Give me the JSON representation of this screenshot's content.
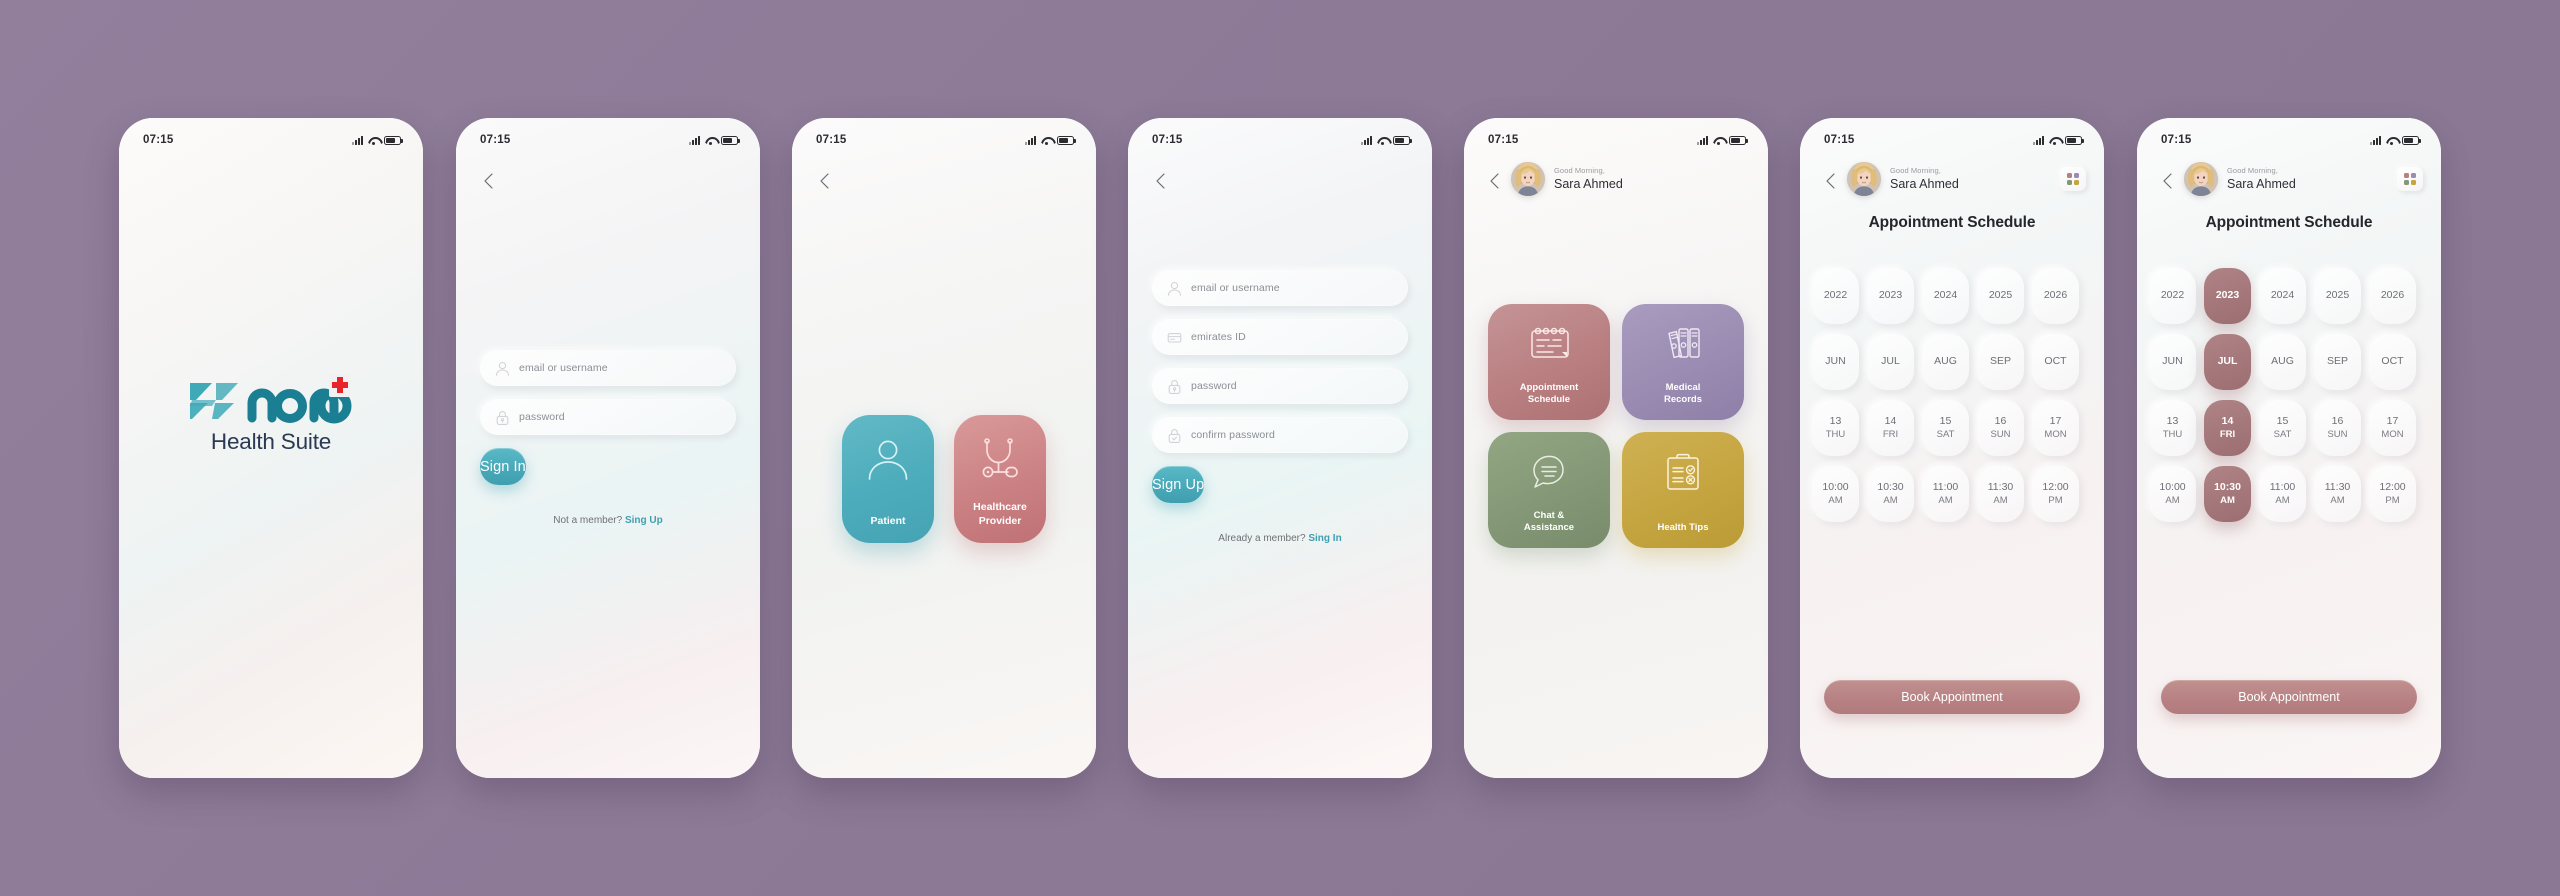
{
  "meta": {
    "background_color": "#8e7c99",
    "app_name": "Nano Health Suite"
  },
  "status_bar": {
    "time": "07:15",
    "icons": [
      "signal-icon",
      "wifi-icon",
      "battery-icon"
    ]
  },
  "screens": [
    {
      "id": "splash",
      "name": "splash-screen",
      "logo": {
        "brand_top": "Nano",
        "brand_bottom": "Health Suite",
        "accent_color": "#3a9aad",
        "cross_color": "#e8232a",
        "text_color": "#2b3a52"
      }
    },
    {
      "id": "signin",
      "name": "sign-in-screen",
      "back_icon": "chevron-left-icon",
      "fields": [
        {
          "name": "email-or-username-field",
          "icon": "user-icon",
          "placeholder": "email or username",
          "value": ""
        },
        {
          "name": "password-field",
          "icon": "lock-icon",
          "placeholder": "password",
          "value": ""
        }
      ],
      "submit_label": "Sign In",
      "footnote_text": "Not a member? ",
      "footnote_link": "Sing Up"
    },
    {
      "id": "role",
      "name": "role-selection-screen",
      "back_icon": "chevron-left-icon",
      "roles": [
        {
          "name": "patient-card",
          "label": "Patient",
          "icon": "person-icon",
          "color": "#4eadbc"
        },
        {
          "name": "healthcare-provider-card",
          "label": "Healthcare\nProvider",
          "label_line1": "Healthcare",
          "label_line2": "Provider",
          "icon": "stethoscope-icon",
          "color": "#cd8486"
        }
      ]
    },
    {
      "id": "signup",
      "name": "sign-up-screen",
      "back_icon": "chevron-left-icon",
      "fields": [
        {
          "name": "email-or-username-field",
          "icon": "user-icon",
          "placeholder": "email or username",
          "value": ""
        },
        {
          "name": "emirates-id-field",
          "icon": "id-card-icon",
          "placeholder": "emirates ID",
          "value": ""
        },
        {
          "name": "password-field",
          "icon": "lock-icon",
          "placeholder": "password",
          "value": ""
        },
        {
          "name": "confirm-password-field",
          "icon": "lock-check-icon",
          "placeholder": "confirm password",
          "value": ""
        }
      ],
      "submit_label": "Sign Up",
      "footnote_text": "Already a member? ",
      "footnote_link": "Sing In"
    },
    {
      "id": "home",
      "name": "home-dashboard-screen",
      "back_icon": "chevron-left-icon",
      "greeting_small": "Good Morning,",
      "user_name": "Sara Ahmed",
      "tiles": [
        {
          "name": "tile-appointment-schedule",
          "label_line1": "Appointment",
          "label_line2": "Schedule",
          "icon": "calendar-icon",
          "color": "#b97f81"
        },
        {
          "name": "tile-medical-records",
          "label_line1": "Medical",
          "label_line2": "Records",
          "icon": "binders-icon",
          "color": "#9a8cb2"
        },
        {
          "name": "tile-chat-assistance",
          "label_line1": "Chat &",
          "label_line2": "Assistance",
          "icon": "chat-bubble-icon",
          "color": "#849877"
        },
        {
          "name": "tile-health-tips",
          "label_line1": "Health Tips",
          "label_line2": "",
          "icon": "clipboard-check-icon",
          "color": "#c5a540"
        }
      ]
    },
    {
      "id": "schedule_empty",
      "name": "appointment-schedule-screen",
      "back_icon": "chevron-left-icon",
      "greeting_small": "Good Morning,",
      "user_name": "Sara Ahmed",
      "grid_icon": "grid-menu-icon",
      "title": "Appointment Schedule",
      "rows": [
        {
          "name": "year-row",
          "cells": [
            {
              "primary": "2022",
              "secondary": "",
              "selected": false
            },
            {
              "primary": "2023",
              "secondary": "",
              "selected": false
            },
            {
              "primary": "2024",
              "secondary": "",
              "selected": false
            },
            {
              "primary": "2025",
              "secondary": "",
              "selected": false
            },
            {
              "primary": "2026",
              "secondary": "",
              "selected": false
            }
          ]
        },
        {
          "name": "month-row",
          "cells": [
            {
              "primary": "JUN",
              "secondary": "",
              "selected": false
            },
            {
              "primary": "JUL",
              "secondary": "",
              "selected": false
            },
            {
              "primary": "AUG",
              "secondary": "",
              "selected": false
            },
            {
              "primary": "SEP",
              "secondary": "",
              "selected": false
            },
            {
              "primary": "OCT",
              "secondary": "",
              "selected": false
            }
          ]
        },
        {
          "name": "day-row",
          "cells": [
            {
              "primary": "13",
              "secondary": "THU",
              "selected": false
            },
            {
              "primary": "14",
              "secondary": "FRI",
              "selected": false
            },
            {
              "primary": "15",
              "secondary": "SAT",
              "selected": false
            },
            {
              "primary": "16",
              "secondary": "SUN",
              "selected": false
            },
            {
              "primary": "17",
              "secondary": "MON",
              "selected": false
            }
          ]
        },
        {
          "name": "time-row",
          "cells": [
            {
              "primary": "10:00",
              "secondary": "AM",
              "selected": false
            },
            {
              "primary": "10:30",
              "secondary": "AM",
              "selected": false
            },
            {
              "primary": "11:00",
              "secondary": "AM",
              "selected": false
            },
            {
              "primary": "11:30",
              "secondary": "AM",
              "selected": false
            },
            {
              "primary": "12:00",
              "secondary": "PM",
              "selected": false
            }
          ]
        }
      ],
      "book_label": "Book Appointment"
    },
    {
      "id": "schedule_selected",
      "name": "appointment-schedule-selected-screen",
      "back_icon": "chevron-left-icon",
      "greeting_small": "Good Morning,",
      "user_name": "Sara Ahmed",
      "grid_icon": "grid-menu-icon",
      "title": "Appointment Schedule",
      "selection": {
        "year": "2023",
        "month": "JUL",
        "day": "14",
        "weekday": "FRI",
        "time": "10:30 AM"
      },
      "rows": [
        {
          "name": "year-row",
          "cells": [
            {
              "primary": "2022",
              "secondary": "",
              "selected": false
            },
            {
              "primary": "2023",
              "secondary": "",
              "selected": true
            },
            {
              "primary": "2024",
              "secondary": "",
              "selected": false
            },
            {
              "primary": "2025",
              "secondary": "",
              "selected": false
            },
            {
              "primary": "2026",
              "secondary": "",
              "selected": false
            }
          ]
        },
        {
          "name": "month-row",
          "cells": [
            {
              "primary": "JUN",
              "secondary": "",
              "selected": false
            },
            {
              "primary": "JUL",
              "secondary": "",
              "selected": true
            },
            {
              "primary": "AUG",
              "secondary": "",
              "selected": false
            },
            {
              "primary": "SEP",
              "secondary": "",
              "selected": false
            },
            {
              "primary": "OCT",
              "secondary": "",
              "selected": false
            }
          ]
        },
        {
          "name": "day-row",
          "cells": [
            {
              "primary": "13",
              "secondary": "THU",
              "selected": false
            },
            {
              "primary": "14",
              "secondary": "FRI",
              "selected": true
            },
            {
              "primary": "15",
              "secondary": "SAT",
              "selected": false
            },
            {
              "primary": "16",
              "secondary": "SUN",
              "selected": false
            },
            {
              "primary": "17",
              "secondary": "MON",
              "selected": false
            }
          ]
        },
        {
          "name": "time-row",
          "cells": [
            {
              "primary": "10:00",
              "secondary": "AM",
              "selected": false
            },
            {
              "primary": "10:30",
              "secondary": "AM",
              "selected": true
            },
            {
              "primary": "11:00",
              "secondary": "AM",
              "selected": false
            },
            {
              "primary": "11:30",
              "secondary": "AM",
              "selected": false
            },
            {
              "primary": "12:00",
              "secondary": "PM",
              "selected": false
            }
          ]
        }
      ],
      "book_label": "Book Appointment"
    }
  ],
  "palette": {
    "teal": "#49a9b9",
    "rose": "#b97f81",
    "purple": "#9a8cb2",
    "green": "#849877",
    "gold": "#c5a540",
    "selected_rose": "#a4777a"
  }
}
